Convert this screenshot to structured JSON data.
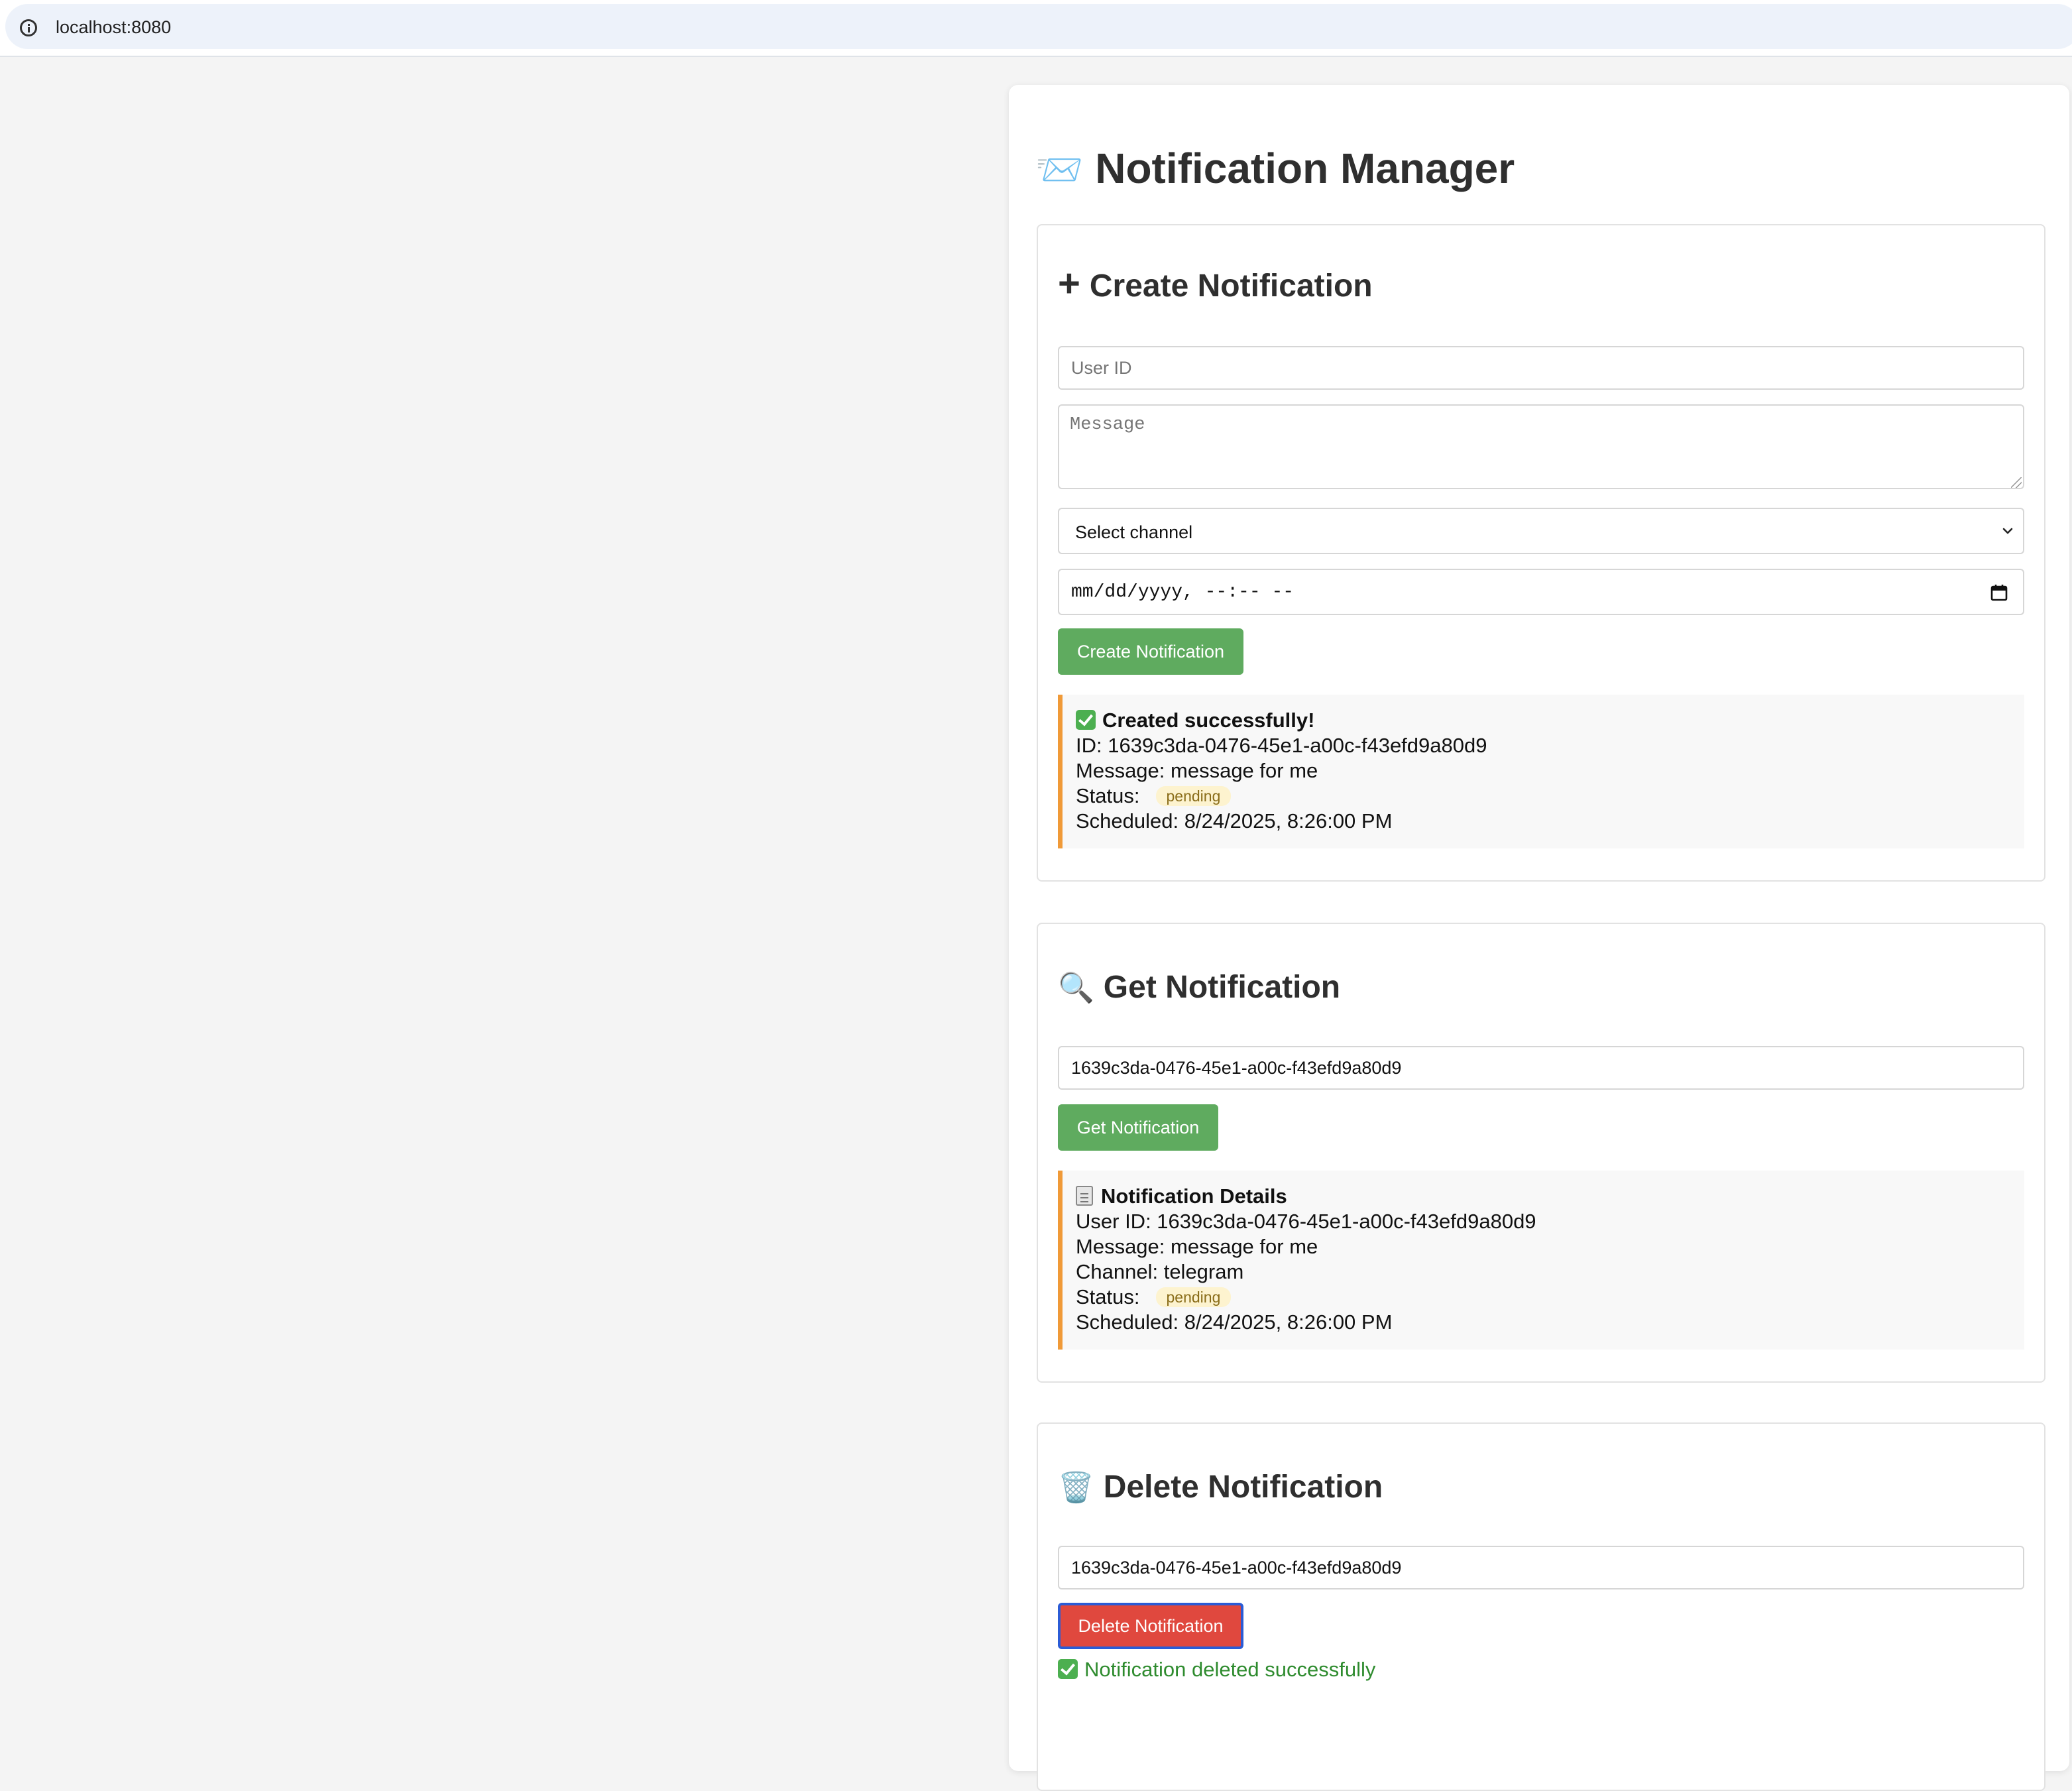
{
  "browser": {
    "url": "localhost:8080"
  },
  "page": {
    "title_emoji": "📨",
    "title": "Notification Manager"
  },
  "create": {
    "title": "Create Notification",
    "user_id_placeholder": "User ID",
    "message_placeholder": "Message",
    "channel_selected": "Select channel",
    "datetime_value": "mm/dd/yyyy, --:-- --",
    "button_label": "Create Notification",
    "result": {
      "heading": "Created successfully!",
      "id_line": "ID: 1639c3da-0476-45e1-a00c-f43efd9a80d9",
      "message_line": "Message: message for me",
      "status_label": "Status:",
      "status_badge": "pending",
      "scheduled_line": "Scheduled: 8/24/2025, 8:26:00 PM"
    }
  },
  "get": {
    "title_emoji": "🔍",
    "title": "Get Notification",
    "id_value": "1639c3da-0476-45e1-a00c-f43efd9a80d9",
    "button_label": "Get Notification",
    "result": {
      "heading": "Notification Details",
      "user_id_line": "User ID: 1639c3da-0476-45e1-a00c-f43efd9a80d9",
      "message_line": "Message: message for me",
      "channel_line": "Channel: telegram",
      "status_label": "Status:",
      "status_badge": "pending",
      "scheduled_line": "Scheduled: 8/24/2025, 8:26:00 PM"
    }
  },
  "delete": {
    "title_emoji": "🗑️",
    "title": "Delete Notification",
    "id_value": "1639c3da-0476-45e1-a00c-f43efd9a80d9",
    "button_label": "Delete Notification",
    "success_message": "Notification deleted successfully"
  },
  "colors": {
    "primary_button": "#5fab5f",
    "danger_button": "#e0483e",
    "result_accent": "#f09a38",
    "success_text": "#2e8b2e",
    "badge_bg": "#fdf3cf"
  }
}
